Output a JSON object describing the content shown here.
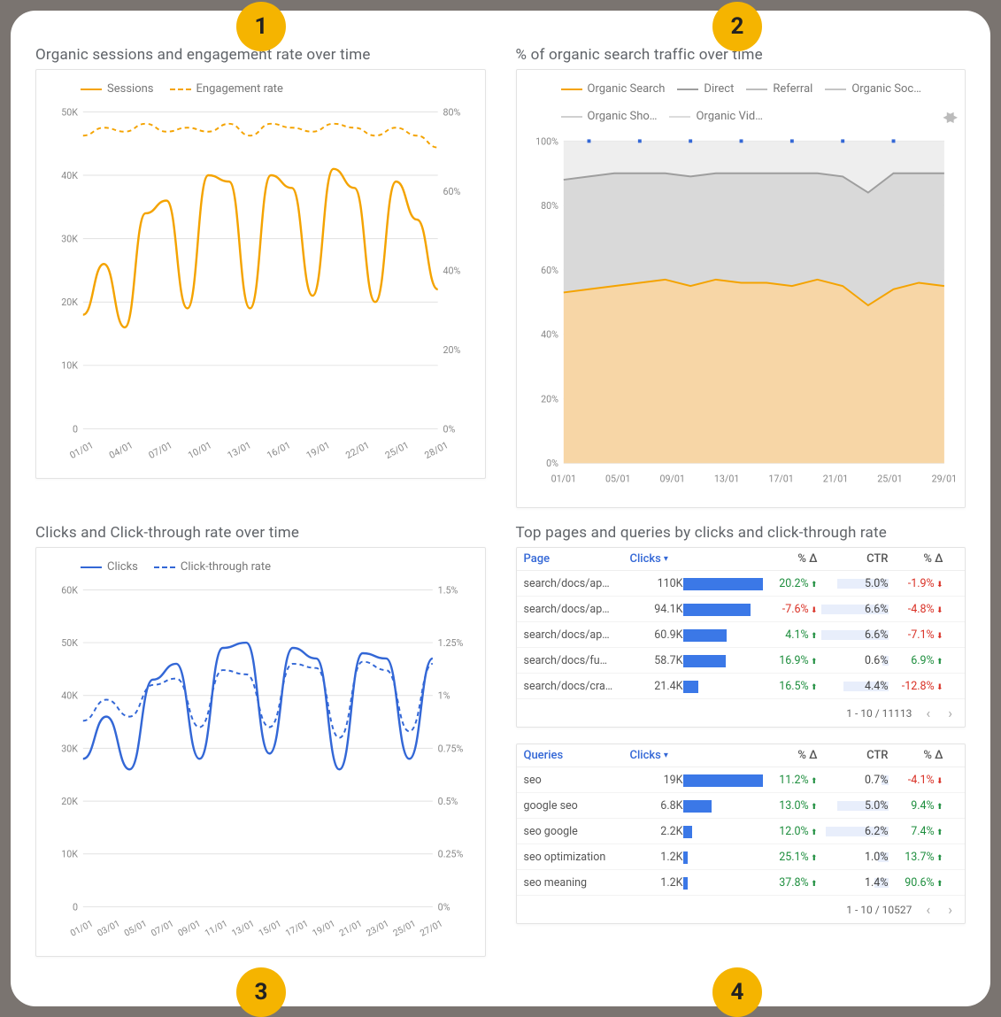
{
  "badges": [
    "1",
    "2",
    "3",
    "4"
  ],
  "panel1": {
    "title": "Organic sessions and engagement rate over time",
    "legend": [
      "Sessions",
      "Engagement rate"
    ]
  },
  "panel2": {
    "title": "% of organic search traffic over time",
    "legend": [
      "Organic Search",
      "Direct",
      "Referral",
      "Organic Soc…",
      "Organic Sho…",
      "Organic Vid…"
    ]
  },
  "panel3": {
    "title": "Clicks and Click-through rate over time",
    "legend": [
      "Clicks",
      "Click-through rate"
    ]
  },
  "panel4": {
    "title": "Top pages and queries by clicks and click-through rate",
    "pages": {
      "headers": [
        "Page",
        "Clicks",
        "% Δ",
        "CTR",
        "% Δ"
      ],
      "rows": [
        {
          "page": "search/docs/ap…",
          "clicks_label": "110K",
          "clicks": 110000,
          "pdelta": "20.2%",
          "pdir": "up",
          "ctr": "5.0%",
          "ctrv": 5.0,
          "cdelta": "-1.9%",
          "cdir": "down"
        },
        {
          "page": "search/docs/ap…",
          "clicks_label": "94.1K",
          "clicks": 94100,
          "pdelta": "-7.6%",
          "pdir": "down",
          "ctr": "6.6%",
          "ctrv": 6.6,
          "cdelta": "-4.8%",
          "cdir": "down"
        },
        {
          "page": "search/docs/ap…",
          "clicks_label": "60.9K",
          "clicks": 60900,
          "pdelta": "4.1%",
          "pdir": "up",
          "ctr": "6.6%",
          "ctrv": 6.6,
          "cdelta": "-7.1%",
          "cdir": "down"
        },
        {
          "page": "search/docs/fu…",
          "clicks_label": "58.7K",
          "clicks": 58700,
          "pdelta": "16.9%",
          "pdir": "up",
          "ctr": "0.6%",
          "ctrv": 0.6,
          "cdelta": "6.9%",
          "cdir": "up"
        },
        {
          "page": "search/docs/cra…",
          "clicks_label": "21.4K",
          "clicks": 21400,
          "pdelta": "16.5%",
          "pdir": "up",
          "ctr": "4.4%",
          "ctrv": 4.4,
          "cdelta": "-12.8%",
          "cdir": "down"
        }
      ],
      "pager": "1 - 10 / 11113"
    },
    "queries": {
      "headers": [
        "Queries",
        "Clicks",
        "% Δ",
        "CTR",
        "% Δ"
      ],
      "rows": [
        {
          "q": "seo",
          "clicks_label": "19K",
          "clicks": 19000,
          "pdelta": "11.2%",
          "pdir": "up",
          "ctr": "0.7%",
          "ctrv": 0.7,
          "cdelta": "-4.1%",
          "cdir": "down"
        },
        {
          "q": "google seo",
          "clicks_label": "6.8K",
          "clicks": 6800,
          "pdelta": "13.0%",
          "pdir": "up",
          "ctr": "5.0%",
          "ctrv": 5.0,
          "cdelta": "9.4%",
          "cdir": "up"
        },
        {
          "q": "seo google",
          "clicks_label": "2.2K",
          "clicks": 2200,
          "pdelta": "12.0%",
          "pdir": "up",
          "ctr": "6.2%",
          "ctrv": 6.2,
          "cdelta": "7.4%",
          "cdir": "up"
        },
        {
          "q": "seo optimization",
          "clicks_label": "1.2K",
          "clicks": 1200,
          "pdelta": "25.1%",
          "pdir": "up",
          "ctr": "1.0%",
          "ctrv": 1.0,
          "cdelta": "13.7%",
          "cdir": "up"
        },
        {
          "q": "seo meaning",
          "clicks_label": "1.2K",
          "clicks": 1200,
          "pdelta": "37.8%",
          "pdir": "up",
          "ctr": "1.4%",
          "ctrv": 1.4,
          "cdelta": "90.6%",
          "cdir": "up"
        }
      ],
      "pager": "1 - 10 / 10527"
    }
  },
  "chart_data": [
    {
      "id": "sessions_engagement",
      "type": "line",
      "x_labels": [
        "01/01",
        "04/01",
        "07/01",
        "10/01",
        "13/01",
        "16/01",
        "19/01",
        "22/01",
        "25/01",
        "28/01"
      ],
      "y_left": {
        "label": "Sessions",
        "ticks": [
          0,
          10000,
          20000,
          30000,
          40000,
          50000
        ],
        "tick_labels": [
          "0",
          "10K",
          "20K",
          "30K",
          "40K",
          "50K"
        ]
      },
      "y_right": {
        "label": "Engagement rate",
        "ticks": [
          0,
          20,
          40,
          60,
          80
        ],
        "tick_labels": [
          "0%",
          "20%",
          "40%",
          "60%",
          "80%"
        ]
      },
      "series": [
        {
          "name": "Sessions",
          "axis": "left",
          "color": "#f4a300",
          "values": [
            18000,
            26000,
            16000,
            34000,
            36000,
            19000,
            40000,
            39000,
            19000,
            40000,
            38000,
            21000,
            41000,
            38000,
            20000,
            39000,
            33000,
            22000
          ]
        },
        {
          "name": "Engagement rate",
          "axis": "right",
          "color": "#f4a300",
          "style": "dash",
          "values": [
            74,
            76,
            75,
            77,
            75,
            76,
            75,
            77,
            74,
            77,
            76,
            75,
            77,
            76,
            74,
            76,
            74,
            71
          ]
        }
      ]
    },
    {
      "id": "traffic_share",
      "type": "area",
      "x_labels": [
        "01/01",
        "05/01",
        "09/01",
        "13/01",
        "17/01",
        "21/01",
        "25/01",
        "29/01"
      ],
      "y": {
        "ticks": [
          0,
          20,
          40,
          60,
          80,
          100
        ],
        "tick_labels": [
          "0%",
          "20%",
          "40%",
          "60%",
          "80%",
          "100%"
        ]
      },
      "series": [
        {
          "name": "Organic Search",
          "color": "#f4a300",
          "values": [
            53,
            54,
            55,
            56,
            57,
            55,
            57,
            56,
            56,
            55,
            57,
            55,
            49,
            54,
            56,
            55
          ]
        },
        {
          "name": "Direct",
          "color": "#9e9e9e",
          "top_values": [
            88,
            89,
            90,
            90,
            90,
            89,
            90,
            90,
            90,
            90,
            90,
            89,
            84,
            90,
            90,
            90
          ]
        },
        {
          "name": "Referral",
          "color": "#bdbdbd",
          "top_values": [
            100,
            100,
            100,
            100,
            100,
            100,
            100,
            100,
            100,
            100,
            100,
            100,
            100,
            100,
            100,
            100
          ]
        }
      ]
    },
    {
      "id": "clicks_ctr",
      "type": "line",
      "x_labels": [
        "01/01",
        "03/01",
        "05/01",
        "07/01",
        "09/01",
        "11/01",
        "13/01",
        "15/01",
        "17/01",
        "19/01",
        "21/01",
        "23/01",
        "25/01",
        "27/01"
      ],
      "y_left": {
        "label": "Clicks",
        "ticks": [
          0,
          10000,
          20000,
          30000,
          40000,
          50000,
          60000
        ],
        "tick_labels": [
          "0",
          "10K",
          "20K",
          "30K",
          "40K",
          "50K",
          "60K"
        ]
      },
      "y_right": {
        "label": "Click-through rate",
        "ticks": [
          0,
          0.25,
          0.5,
          0.75,
          1.0,
          1.25,
          1.5
        ],
        "tick_labels": [
          "0%",
          "0.25%",
          "0.5%",
          "0.75%",
          "1%",
          "1.25%",
          "1.5%"
        ]
      },
      "series": [
        {
          "name": "Clicks",
          "axis": "left",
          "color": "#3367d6",
          "values": [
            28000,
            36000,
            26000,
            43000,
            46000,
            28000,
            49000,
            50000,
            29000,
            49000,
            47000,
            26000,
            48000,
            47000,
            28000,
            47000
          ]
        },
        {
          "name": "Click-through rate",
          "axis": "right",
          "color": "#3367d6",
          "style": "dash",
          "values": [
            0.88,
            0.98,
            0.9,
            1.05,
            1.08,
            0.85,
            1.12,
            1.1,
            0.85,
            1.15,
            1.13,
            0.8,
            1.16,
            1.12,
            0.83,
            1.15
          ]
        }
      ]
    }
  ]
}
